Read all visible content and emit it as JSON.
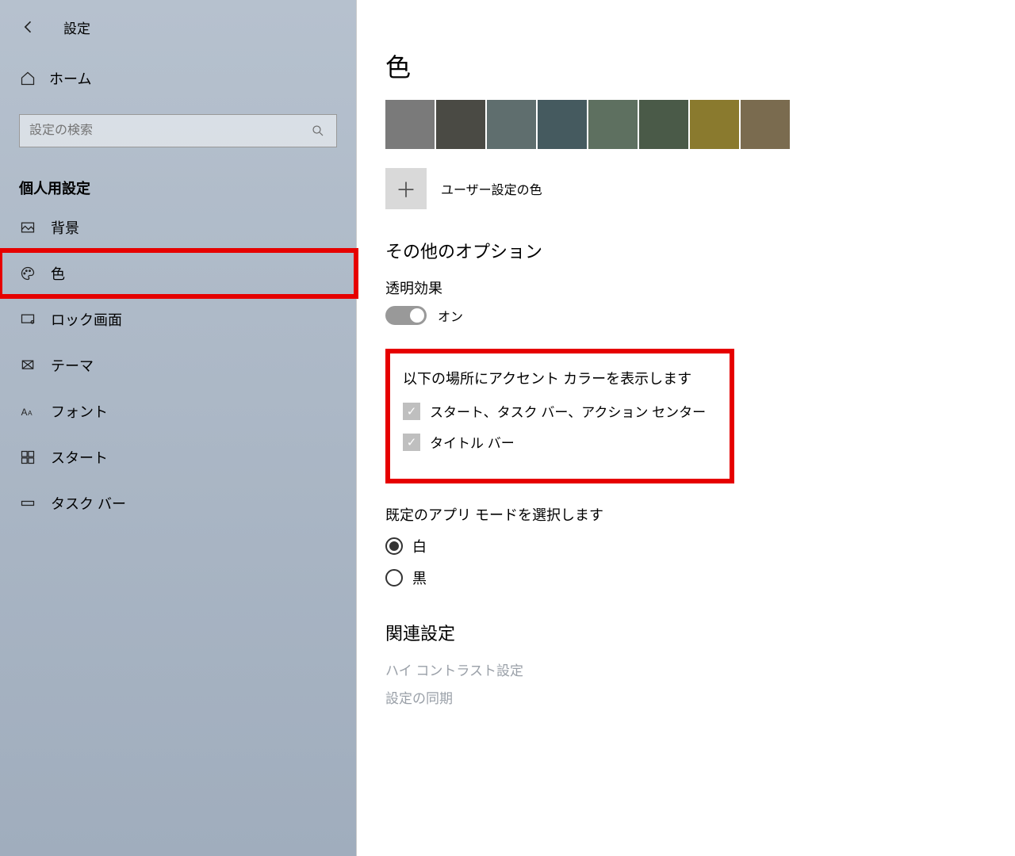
{
  "header": {
    "title": "設定"
  },
  "sidebar": {
    "home": "ホーム",
    "search_placeholder": "設定の検索",
    "section": "個人用設定",
    "items": [
      {
        "label": "背景"
      },
      {
        "label": "色"
      },
      {
        "label": "ロック画面"
      },
      {
        "label": "テーマ"
      },
      {
        "label": "フォント"
      },
      {
        "label": "スタート"
      },
      {
        "label": "タスク バー"
      }
    ]
  },
  "main": {
    "title": "色",
    "swatches": [
      "#7a7a7a",
      "#4a4a44",
      "#5f6e6e",
      "#455a5f",
      "#5e7060",
      "#4a5a48",
      "#8a7a2e",
      "#7a6b4f"
    ],
    "custom_color": "ユーザー設定の色",
    "other_options": "その他のオプション",
    "transparency": {
      "label": "透明効果",
      "state": "オン"
    },
    "accent": {
      "head": "以下の場所にアクセント カラーを表示します",
      "opt1": "スタート、タスク バー、アクション センター",
      "opt2": "タイトル バー"
    },
    "app_mode": {
      "head": "既定のアプリ モードを選択します",
      "white": "白",
      "black": "黒"
    },
    "related": {
      "head": "関連設定",
      "link1": "ハイ コントラスト設定",
      "link2": "設定の同期"
    }
  }
}
